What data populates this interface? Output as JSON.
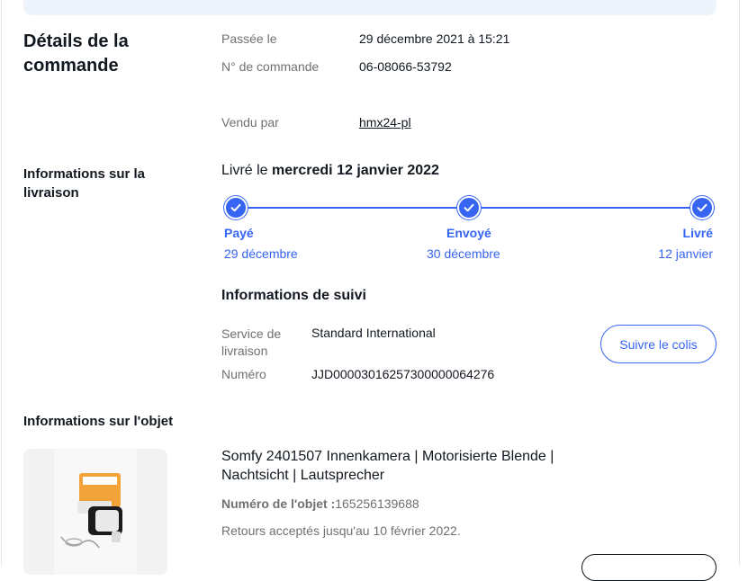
{
  "order_details": {
    "title": "Détails de la commande",
    "placed_label": "Passée le",
    "placed_value": "29 décembre 2021 à 15:21",
    "order_number_label": "N° de commande",
    "order_number_value": "06-08066-53792",
    "sold_by_label": "Vendu par",
    "sold_by_value": "hmx24-pl"
  },
  "delivery": {
    "title": "Informations sur la livraison",
    "delivered_prefix": "Livré le",
    "delivered_date": "mercredi 12 janvier 2022",
    "steps": [
      {
        "status": "Payé",
        "date": "29 décembre"
      },
      {
        "status": "Envoyé",
        "date": "30 décembre"
      },
      {
        "status": "Livré",
        "date": "12 janvier"
      }
    ],
    "tracking_title": "Informations de suivi",
    "service_label": "Service de livraison",
    "service_value": "Standard International",
    "number_label": "Numéro",
    "number_value": "JJD00003016257300000064276",
    "track_button": "Suivre le colis"
  },
  "item": {
    "section_title": "Informations sur l'objet",
    "title": "Somfy 2401507 Innenkamera | Motorisierte Blende | Nachtsicht | Lautsprecher",
    "number_label": "Numéro de l'objet :",
    "number_value": "165256139688",
    "returns": "Retours acceptés jusqu'au 10 février 2022."
  },
  "colors": {
    "accent": "#3665f3",
    "text": "#111820",
    "muted": "#707070",
    "banner": "#eef4fb"
  },
  "icons": {
    "step_check": "check-icon",
    "item_image": "product-image"
  }
}
